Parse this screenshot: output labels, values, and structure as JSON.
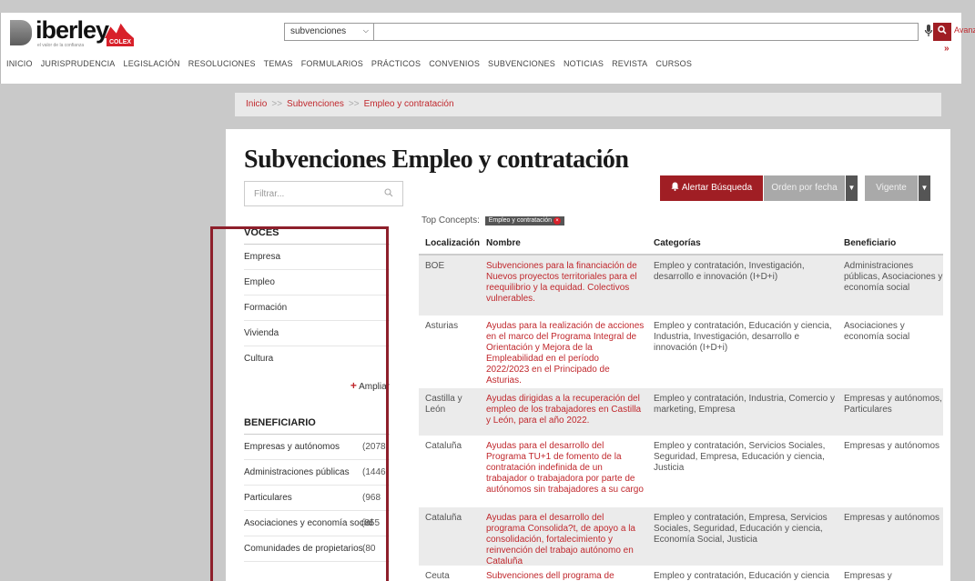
{
  "header": {
    "logo_text": "iberley",
    "logo_tagline": "el valor de la confianza",
    "colex_label": "COLEX",
    "search_scope": "subvenciones",
    "search_value": "",
    "avanzado_label": "Avanzado",
    "more_label": "»"
  },
  "nav": {
    "items": [
      "INICIO",
      "JURISPRUDENCIA",
      "LEGISLACIÓN",
      "RESOLUCIONES",
      "TEMAS",
      "FORMULARIOS",
      "PRÁCTICOS",
      "CONVENIOS",
      "SUBVENCIONES",
      "NOTICIAS",
      "REVISTA",
      "CURSOS"
    ]
  },
  "breadcrumb": {
    "items": [
      "Inicio",
      "Subvenciones",
      "Empleo y contratación"
    ],
    "separator": ">>"
  },
  "page": {
    "title": "Subvenciones Empleo y contratación",
    "filter_placeholder": "Filtrar...",
    "alert_button": "Alertar Búsqueda",
    "order_button": "Orden por fecha",
    "vigente_button": "Vigente",
    "top_concepts_label": "Top Concepts:",
    "top_concept_chip": "Empleo y contratación"
  },
  "facets": {
    "voces_title": "VOCES",
    "voces": [
      "Empresa",
      "Empleo",
      "Formación",
      "Vivienda",
      "Cultura"
    ],
    "ampliar_label": "Ampliar",
    "beneficiario_title": "BENEFICIARIO",
    "beneficiario": [
      {
        "label": "Empresas y autónomos",
        "count": "(2078"
      },
      {
        "label": "Administraciones públicas",
        "count": "(1446"
      },
      {
        "label": "Particulares",
        "count": "(968"
      },
      {
        "label": "Asociaciones y economía social",
        "count": "(855"
      },
      {
        "label": "Comunidades de propietarios",
        "count": "(80"
      }
    ]
  },
  "table": {
    "headers": [
      "Localización",
      "Nombre",
      "Categorías",
      "Beneficiario"
    ],
    "rows": [
      {
        "loc": "BOE",
        "name": "Subvenciones para la financiación de Nuevos proyectos territoriales para el reequilibrio y la equidad. Colectivos vulnerables.",
        "cat": "Empleo y contratación, Investigación, desarrollo e innovación (I+D+i)",
        "ben": "Administraciones públicas, Asociaciones y economía social"
      },
      {
        "loc": "Asturias",
        "name": "Ayudas para la realización de acciones en el marco del Programa Integral de Orientación y Mejora de la Empleabilidad en el período 2022/2023 en el Principado de Asturias.",
        "cat": "Empleo y contratación, Educación y ciencia, Industria, Investigación, desarrollo e innovación (I+D+i)",
        "ben": "Asociaciones y economía social"
      },
      {
        "loc": "Castilla y León",
        "name": "Ayudas dirigidas a la recuperación del empleo de los trabajadores en Castilla y León, para el año 2022.",
        "cat": "Empleo y contratación, Industria, Comercio y marketing, Empresa",
        "ben": "Empresas y autónomos, Particulares"
      },
      {
        "loc": "Cataluña",
        "name": "Ayudas para el desarrollo del Programa TU+1 de fomento de la contratación indefinida de un trabajador o trabajadora por parte de autónomos sin trabajadores a su cargo",
        "cat": "Empleo y contratación, Servicios Sociales, Seguridad, Empresa, Educación y ciencia, Justicia",
        "ben": "Empresas y autónomos"
      },
      {
        "loc": "Cataluña",
        "name": "Ayudas para el desarrollo del programa Consolida?t, de apoyo a la consolidación, fortalecimiento y reinvención del trabajo autónomo en Cataluña",
        "cat": "Empleo y contratación, Empresa, Servicios Sociales, Seguridad, Educación y ciencia, Economía Social, Justicia",
        "ben": "Empresas y autónomos"
      },
      {
        "loc": "Ceuta",
        "name": "Subvenciones dell programa de Escuelas",
        "cat": "Empleo y contratación, Educación y ciencia",
        "ben": "Empresas y"
      }
    ]
  }
}
